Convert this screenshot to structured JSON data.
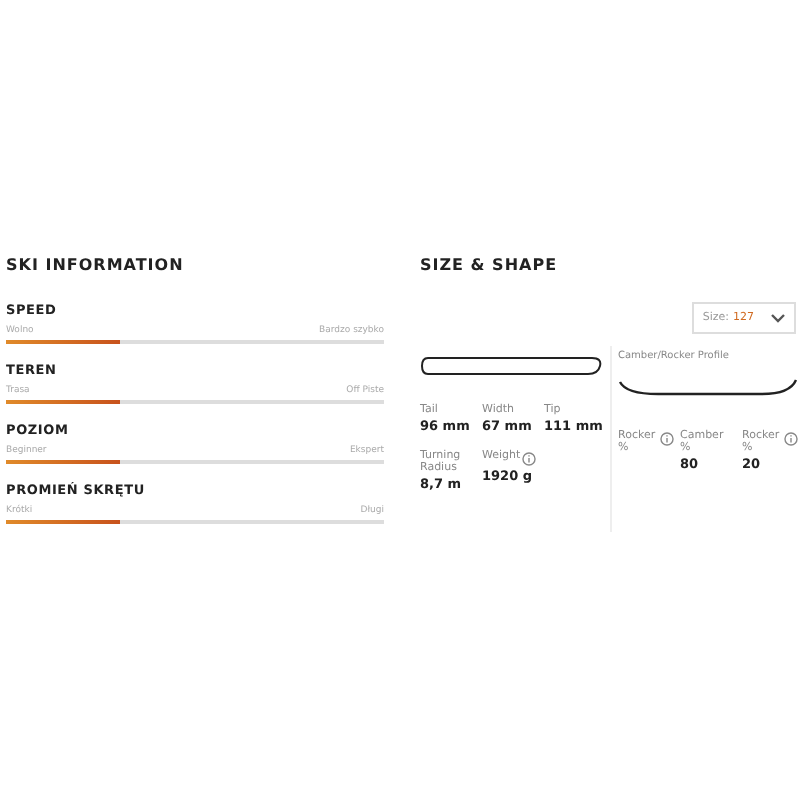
{
  "ski_information": {
    "title": "SKI INFORMATION",
    "scales": [
      {
        "label": "SPEED",
        "min": "Wolno",
        "max": "Bardzo szybko",
        "level": 0.3
      },
      {
        "label": "TEREN",
        "min": "Trasa",
        "max": "Off Piste",
        "level": 0.3
      },
      {
        "label": "POZIOM",
        "min": "Beginner",
        "max": "Ekspert",
        "level": 0.3
      },
      {
        "label": "PROMIEŃ SKRĘTU",
        "min": "Krótki",
        "max": "Długi",
        "level": 0.3
      }
    ]
  },
  "size_shape": {
    "title": "SIZE & SHAPE",
    "size_select": {
      "label": "Size:",
      "value": "127"
    },
    "specs": [
      {
        "label": "Tail",
        "value": "96 mm",
        "info": false
      },
      {
        "label": "Width",
        "value": "67 mm",
        "info": false
      },
      {
        "label": "Tip",
        "value": "111 mm",
        "info": false
      },
      {
        "label": "Turning Radius",
        "value": "8,7 m",
        "info": false
      },
      {
        "label": "Weight",
        "value": "1920 g",
        "info": true
      }
    ],
    "profile": {
      "title": "Camber/Rocker Profile",
      "items": [
        {
          "label": "Rocker %",
          "info": true
        },
        {
          "label": "Camber %",
          "value": "80",
          "info": false
        },
        {
          "label": "Rocker %",
          "value": "20",
          "info": true
        }
      ]
    }
  }
}
